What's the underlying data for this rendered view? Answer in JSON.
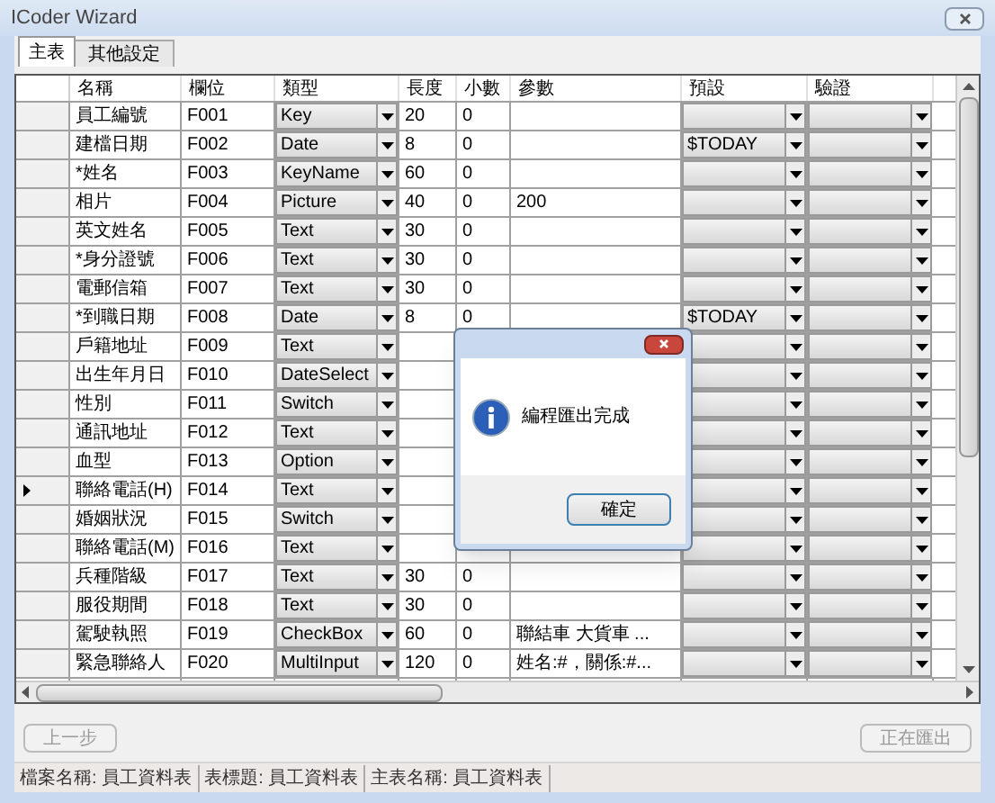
{
  "window": {
    "title": "ICoder Wizard"
  },
  "tabs": [
    {
      "label": "主表",
      "selected": true
    },
    {
      "label": "其他設定",
      "selected": false
    }
  ],
  "table": {
    "columns": [
      "名稱",
      "欄位",
      "類型",
      "長度",
      "小數",
      "參數",
      "預設",
      "驗證"
    ],
    "rows": [
      {
        "name": "員工編號",
        "field": "F001",
        "type": "Key",
        "length": "20",
        "decimals": "0",
        "param": "",
        "default": "",
        "current": false
      },
      {
        "name": "建檔日期",
        "field": "F002",
        "type": "Date",
        "length": "8",
        "decimals": "0",
        "param": "",
        "default": "$TODAY",
        "current": false
      },
      {
        "name": "*姓名",
        "field": "F003",
        "type": "KeyName",
        "length": "60",
        "decimals": "0",
        "param": "",
        "default": "",
        "current": false
      },
      {
        "name": "相片",
        "field": "F004",
        "type": "Picture",
        "length": "40",
        "decimals": "0",
        "param": "200",
        "default": "",
        "current": false
      },
      {
        "name": "英文姓名",
        "field": "F005",
        "type": "Text",
        "length": "30",
        "decimals": "0",
        "param": "",
        "default": "",
        "current": false
      },
      {
        "name": "*身分證號",
        "field": "F006",
        "type": "Text",
        "length": "30",
        "decimals": "0",
        "param": "",
        "default": "",
        "current": false
      },
      {
        "name": "電郵信箱",
        "field": "F007",
        "type": "Text",
        "length": "30",
        "decimals": "0",
        "param": "",
        "default": "",
        "current": false
      },
      {
        "name": "*到職日期",
        "field": "F008",
        "type": "Date",
        "length": "8",
        "decimals": "0",
        "param": "",
        "default": "$TODAY",
        "current": false
      },
      {
        "name": "戶籍地址",
        "field": "F009",
        "type": "Text",
        "default": "",
        "current": false
      },
      {
        "name": "出生年月日",
        "field": "F010",
        "type": "DateSelect",
        "default": "",
        "current": false
      },
      {
        "name": "性別",
        "field": "F011",
        "type": "Switch",
        "default": "",
        "current": false
      },
      {
        "name": "通訊地址",
        "field": "F012",
        "type": "Text",
        "default": "",
        "current": false
      },
      {
        "name": "血型",
        "field": "F013",
        "type": "Option",
        "default": "",
        "current": false
      },
      {
        "name": "聯絡電話(H)",
        "field": "F014",
        "type": "Text",
        "default": "",
        "current": true
      },
      {
        "name": "婚姻狀況",
        "field": "F015",
        "type": "Switch",
        "default": "",
        "current": false
      },
      {
        "name": "聯絡電話(M)",
        "field": "F016",
        "type": "Text",
        "default": "",
        "current": false
      },
      {
        "name": "兵種階級",
        "field": "F017",
        "type": "Text",
        "length": "30",
        "decimals": "0",
        "param": "",
        "default": "",
        "current": false
      },
      {
        "name": "服役期間",
        "field": "F018",
        "type": "Text",
        "length": "30",
        "decimals": "0",
        "param": "",
        "default": "",
        "current": false
      },
      {
        "name": "駕駛執照",
        "field": "F019",
        "type": "CheckBox",
        "length": "60",
        "decimals": "0",
        "param": "聯結車 大貨車 ...",
        "default": "",
        "current": false
      },
      {
        "name": "緊急聯絡人",
        "field": "F020",
        "type": "MultiInput",
        "length": "120",
        "decimals": "0",
        "param": "姓名:#，關係:#...",
        "default": "",
        "current": false
      }
    ]
  },
  "dialog": {
    "message": "編程匯出完成",
    "button": "確定"
  },
  "buttons": [
    {
      "label": "上一步",
      "disabled": true
    },
    {
      "label": "正在匯出",
      "disabled": true
    }
  ],
  "status_bar": [
    "檔案名稱: 員工資料表",
    "表標題: 員工資料表",
    "主表名稱: 員工資料表"
  ]
}
